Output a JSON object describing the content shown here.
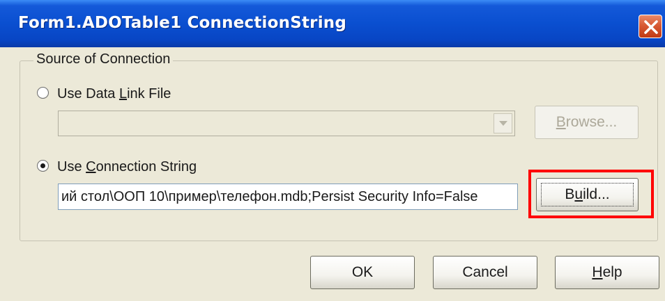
{
  "window": {
    "title": "Form1.ADOTable1 ConnectionString"
  },
  "group": {
    "legend": "Source of Connection"
  },
  "options": {
    "data_link_file": {
      "pre": "Use Data ",
      "accel": "L",
      "post": "ink File",
      "selected": false
    },
    "connection_string": {
      "pre": "Use ",
      "accel": "C",
      "post": "onnection String",
      "selected": true
    }
  },
  "data_link_combo": {
    "value": ""
  },
  "browse_button": {
    "accel": "B",
    "rest": "rowse...",
    "enabled": false
  },
  "connection_string_field": {
    "value": "ий стол\\ООП 10\\пример\\телефон.mdb;Persist Security Info=False"
  },
  "build_button": {
    "pre": "B",
    "accel": "u",
    "post": "ild..."
  },
  "buttons": {
    "ok": "OK",
    "cancel": "Cancel",
    "help_accel": "H",
    "help_rest": "elp"
  },
  "colors": {
    "titlebar": "#0a4fd0",
    "dialog_bg": "#ece9d8",
    "highlight": "#ff0000"
  }
}
